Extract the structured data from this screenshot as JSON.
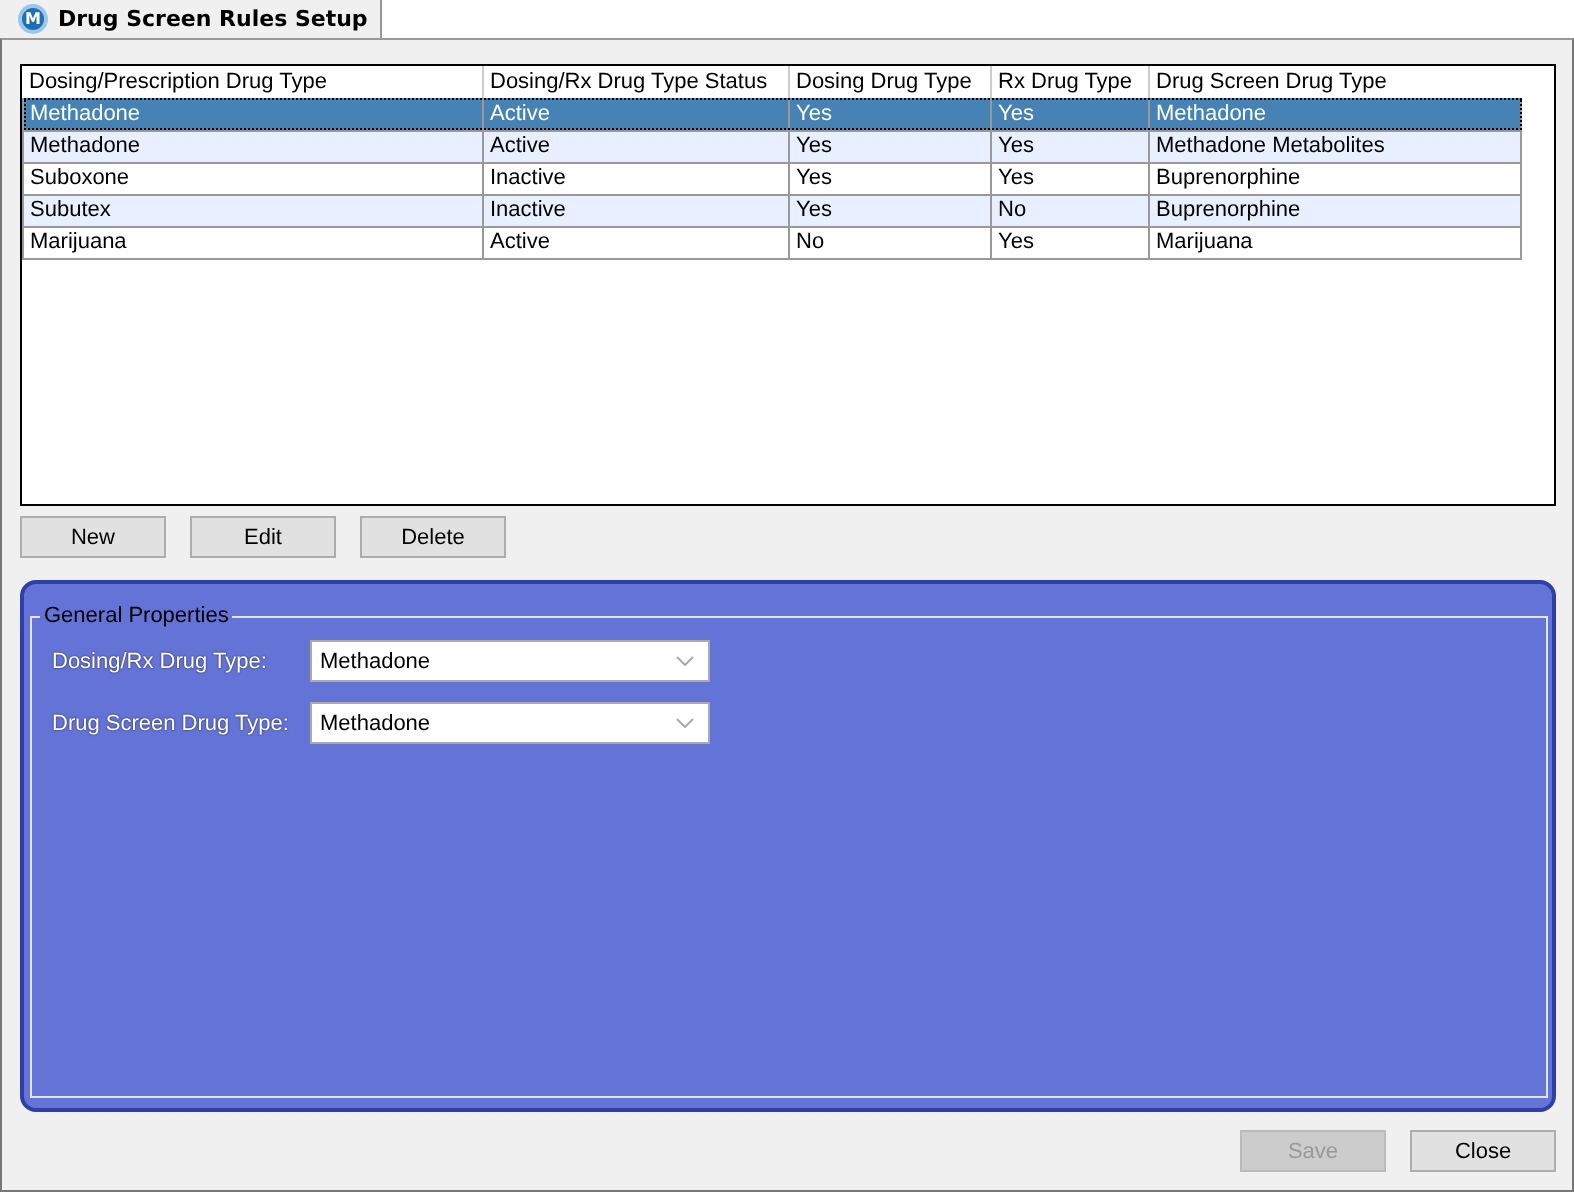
{
  "tab": {
    "title": "Drug Screen Rules Setup",
    "logo": "M"
  },
  "table": {
    "columns": [
      "Dosing/Prescription Drug Type",
      "Dosing/Rx Drug Type Status",
      "Dosing Drug Type",
      "Rx Drug Type",
      "Drug Screen Drug Type"
    ],
    "rows": [
      {
        "selected": true,
        "cells": [
          "Methadone",
          "Active",
          "Yes",
          "Yes",
          "Methadone"
        ]
      },
      {
        "selected": false,
        "cells": [
          "Methadone",
          "Active",
          "Yes",
          "Yes",
          "Methadone Metabolites"
        ]
      },
      {
        "selected": false,
        "cells": [
          "Suboxone",
          "Inactive",
          "Yes",
          "Yes",
          "Buprenorphine"
        ]
      },
      {
        "selected": false,
        "cells": [
          "Subutex",
          "Inactive",
          "Yes",
          "No",
          "Buprenorphine"
        ]
      },
      {
        "selected": false,
        "cells": [
          "Marijuana",
          "Active",
          "No",
          "Yes",
          "Marijuana"
        ]
      }
    ]
  },
  "row_buttons": [
    "New",
    "Edit",
    "Delete"
  ],
  "general_properties": {
    "title": "General Properties",
    "fields": [
      {
        "label": "Dosing/Rx Drug Type:",
        "value": "Methadone"
      },
      {
        "label": "Drug Screen Drug Type:",
        "value": "Methadone"
      }
    ]
  },
  "footer_buttons": [
    {
      "label": "Save",
      "disabled": true
    },
    {
      "label": "Close",
      "disabled": false
    }
  ]
}
